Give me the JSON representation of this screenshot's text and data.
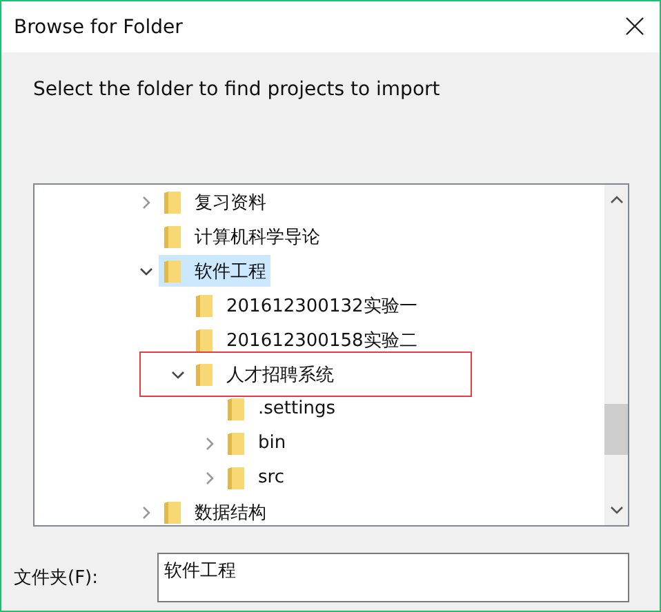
{
  "window": {
    "title": "Browse for Folder"
  },
  "instruction": "Select the folder to find projects to import",
  "tree": {
    "items": [
      {
        "label": "复习资料",
        "has_children": true,
        "expanded": false,
        "selected": false,
        "marked": false
      },
      {
        "label": "计算机科学导论",
        "has_children": false,
        "selected": false,
        "marked": false
      },
      {
        "label": "软件工程",
        "has_children": true,
        "expanded": true,
        "selected": true,
        "marked": false,
        "children": [
          {
            "label": "201612300132实验一",
            "has_children": false,
            "selected": false,
            "marked": false
          },
          {
            "label": "201612300158实验二",
            "has_children": false,
            "selected": false,
            "marked": false
          },
          {
            "label": "人才招聘系统",
            "has_children": true,
            "expanded": true,
            "selected": false,
            "marked": true,
            "children": [
              {
                "label": ".settings",
                "has_children": false,
                "selected": false,
                "marked": false
              },
              {
                "label": "bin",
                "has_children": true,
                "expanded": false,
                "selected": false,
                "marked": false
              },
              {
                "label": "src",
                "has_children": true,
                "expanded": false,
                "selected": false,
                "marked": false
              }
            ]
          }
        ]
      },
      {
        "label": "数据结构",
        "has_children": true,
        "expanded": false,
        "selected": false,
        "marked": false
      }
    ]
  },
  "folder_field": {
    "label": "文件夹(F):",
    "value": "软件工程"
  }
}
